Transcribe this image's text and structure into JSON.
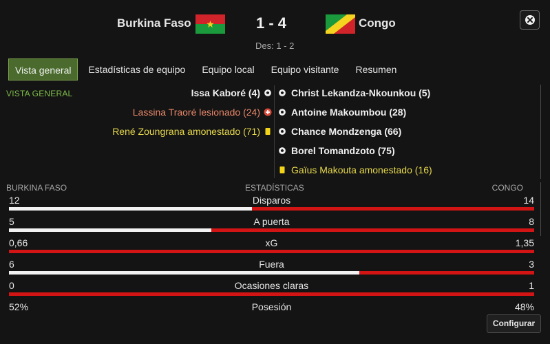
{
  "match": {
    "home_team": "Burkina Faso",
    "away_team": "Congo",
    "score": "1 - 4",
    "halftime": "Des: 1 - 2"
  },
  "tabs": [
    {
      "label": "Vista general",
      "active": true
    },
    {
      "label": "Estadísticas de equipo",
      "active": false
    },
    {
      "label": "Equipo local",
      "active": false
    },
    {
      "label": "Equipo visitante",
      "active": false
    },
    {
      "label": "Resumen",
      "active": false
    }
  ],
  "overview_label": "VISTA GENERAL",
  "home_events": [
    {
      "text": "Issa Kaboré (4)",
      "type": "goal",
      "icon": "ball-icon"
    },
    {
      "text": "Lassina Traoré lesionado (24)",
      "type": "injury",
      "icon": "injury-icon"
    },
    {
      "text": "René Zoungrana amonestado (71)",
      "type": "yellow",
      "icon": "yellow-card-icon"
    }
  ],
  "away_events": [
    {
      "text": "Christ Lekandza-Nkounkou (5)",
      "type": "goal",
      "icon": "ball-icon"
    },
    {
      "text": "Antoine Makoumbou (28)",
      "type": "goal",
      "icon": "ball-icon"
    },
    {
      "text": "Chance Mondzenga (66)",
      "type": "goal",
      "icon": "ball-icon"
    },
    {
      "text": "Borel Tomandzoto (75)",
      "type": "goal",
      "icon": "ball-icon"
    },
    {
      "text": "Gaïus Makouta amonestado (16)",
      "type": "yellow",
      "icon": "yellow-card-icon"
    }
  ],
  "stats_header": {
    "home": "BURKINA FASO",
    "title": "ESTADÍSTICAS",
    "away": "CONGO"
  },
  "stats": [
    {
      "label": "Disparos",
      "home": "12",
      "away": "14",
      "home_share": 0.462
    },
    {
      "label": "A puerta",
      "home": "5",
      "away": "8",
      "home_share": 0.385
    },
    {
      "label": "xG",
      "home": "0,66",
      "away": "1,35",
      "home_share": 0.0
    },
    {
      "label": "Fuera",
      "home": "6",
      "away": "3",
      "home_share": 0.667
    },
    {
      "label": "Ocasiones claras",
      "home": "0",
      "away": "1",
      "home_share": 0.0
    },
    {
      "label": "Posesión",
      "home": "52%",
      "away": "48%",
      "home_share": 0.52,
      "no_bar": true
    }
  ],
  "config_button": "Configurar",
  "colors": {
    "accent_green": "#4a6b2d",
    "home_bar": "#f2f2f2",
    "away_bar": "#d31414",
    "yellow": "#e6d84a",
    "injury": "#e8876a"
  }
}
